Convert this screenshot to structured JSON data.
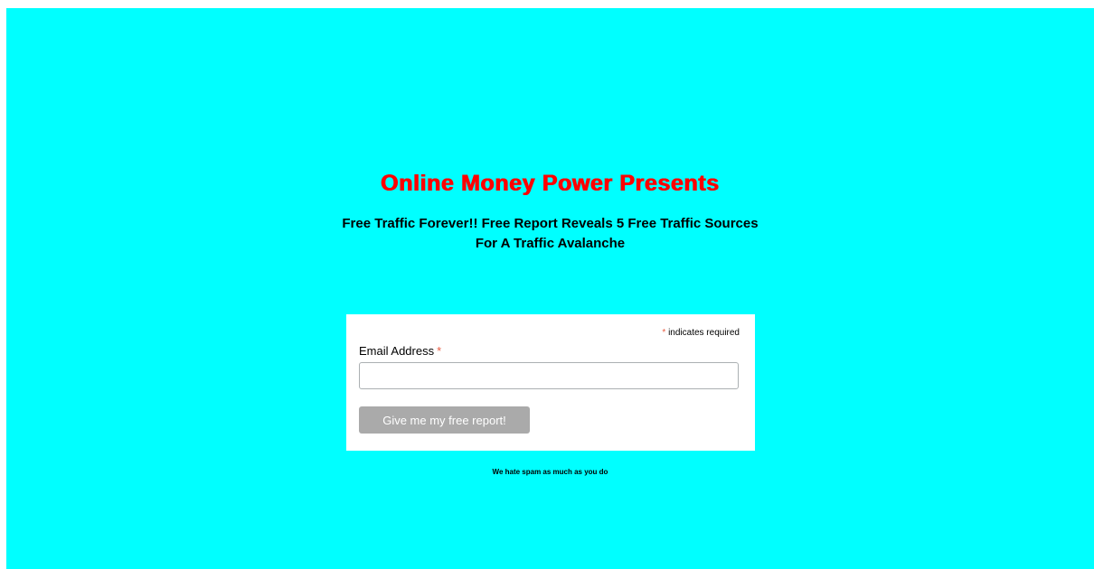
{
  "colors": {
    "background": "#00ffff",
    "headline": "#ff0000",
    "required_asterisk": "#e85c41",
    "button_bg": "#aaaaaa",
    "button_text": "#ffffff"
  },
  "header": {
    "headline": "Online Money Power Presents",
    "subheadline": "Free Traffic Forever!! Free Report Reveals 5 Free Traffic Sources For A Traffic Avalanche"
  },
  "form": {
    "required_asterisk": "*",
    "required_note": "indicates required",
    "email_label": "Email Address",
    "email_value": "",
    "email_placeholder": "",
    "submit_label": "Give me my free report!"
  },
  "footer": {
    "spam_note": "We hate spam as much as you do"
  }
}
